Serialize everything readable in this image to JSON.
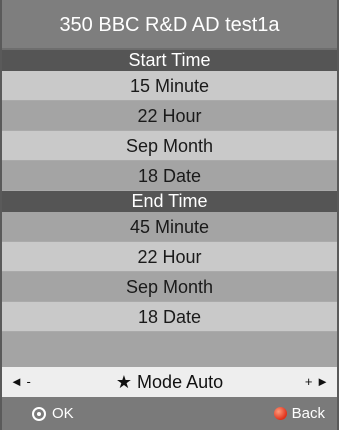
{
  "title": "350 BBC R&D AD test1a",
  "start_section": {
    "header": "Start Time",
    "rows": [
      "15 Minute",
      "22  Hour",
      "Sep Month",
      "18 Date"
    ]
  },
  "end_section": {
    "header": "End Time",
    "rows": [
      "45 Minute",
      "22  Hour",
      "Sep Month",
      "18 Date"
    ]
  },
  "mode_bar": {
    "left": "◄ -",
    "star": "★",
    "label": "Mode Auto",
    "right": "+ ►"
  },
  "footer": {
    "ok_label": "OK",
    "back_label": "Back"
  },
  "colors": {
    "back_button": "#e0301a",
    "header_bg": "#555555"
  },
  "icons": {
    "ok": "ok-circle-icon",
    "back": "red-button-icon",
    "left": "left-arrow-icon",
    "right": "right-arrow-icon",
    "star": "star-icon"
  }
}
